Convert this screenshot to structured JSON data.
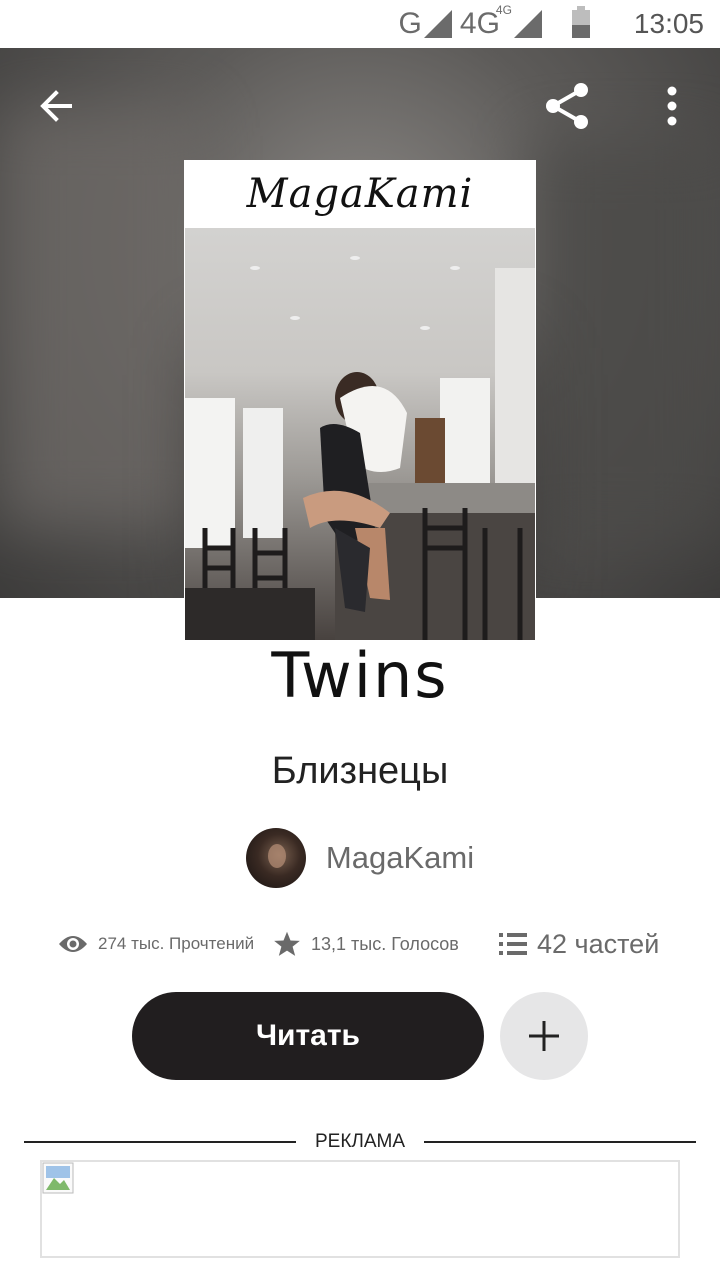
{
  "status_bar": {
    "network": "G",
    "network2": "4G",
    "network2_sup": "4G",
    "time": "13:05"
  },
  "toolbar": {
    "back_icon": "arrow-left-icon",
    "share_icon": "share-icon",
    "more_icon": "more-vert-icon"
  },
  "cover": {
    "author_text": "MagaKami",
    "title_text": "Twins"
  },
  "book": {
    "title": "Близнецы",
    "author": "MagaKami"
  },
  "stats": {
    "reads": "274 тыс. Прочтений",
    "votes": "13,1 тыс. Голосов",
    "parts": "42 частей"
  },
  "actions": {
    "read_label": "Читать",
    "add_icon": "plus-icon"
  },
  "ad": {
    "label": "РЕКЛАМА"
  },
  "colors": {
    "primary_button": "#211e1f",
    "secondary_button": "#e6e6e7",
    "muted_text": "#6a6a6a"
  }
}
